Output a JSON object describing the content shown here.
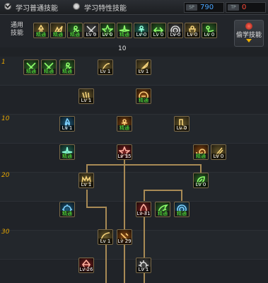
{
  "tabs": {
    "normal_label": "学习普通技能",
    "special_label": "学习特性技能"
  },
  "resources": {
    "sp": {
      "icon": "sp-icon",
      "value": "790",
      "color": "#4aa6ff"
    },
    "tp": {
      "icon": "tp-icon",
      "value": "0",
      "color": "#ff4a3a"
    }
  },
  "common": {
    "label": "通用\n技能",
    "counter": "10",
    "learn_button": "偷学技能",
    "skills": [
      {
        "badge": "精通",
        "tone": "gold",
        "icon": "warrior-icon"
      },
      {
        "badge": "精通",
        "tone": "gold",
        "icon": "leap-icon"
      },
      {
        "badge": "精通",
        "tone": "green",
        "icon": "runner-icon"
      },
      {
        "badge": "Lv 0",
        "tone": "gray",
        "icon": "cross-icon"
      },
      {
        "badge": "Lv 0",
        "tone": "green",
        "icon": "star-icon"
      },
      {
        "badge": "精通",
        "tone": "green",
        "icon": "burst-icon"
      },
      {
        "badge": "Lv 0",
        "tone": "teal",
        "icon": "figure-icon"
      },
      {
        "badge": "Lv 0",
        "tone": "green",
        "icon": "arrows-icon"
      },
      {
        "badge": "Lv 0",
        "tone": "gray",
        "icon": "ring-icon"
      },
      {
        "badge": "Lv 0",
        "tone": "gold",
        "icon": "man-icon"
      },
      {
        "badge": "Lv 0",
        "tone": "green",
        "icon": "kick-icon"
      }
    ]
  },
  "levels": [
    "1",
    "10",
    "20",
    "30"
  ],
  "tree_skills": [
    {
      "badge": "精通",
      "tone": "green",
      "icon": "swords-icon"
    },
    {
      "badge": "精通",
      "tone": "green",
      "icon": "cross-icon"
    },
    {
      "badge": "精通",
      "tone": "green",
      "icon": "runner-icon"
    },
    {
      "badge": "Lv 1",
      "tone": "gold",
      "icon": "slash-icon"
    },
    {
      "badge": "Lv 1",
      "tone": "gold",
      "icon": "blade-icon"
    },
    {
      "badge": "Lv 1",
      "tone": "gold",
      "icon": "claw-icon"
    },
    {
      "badge": "精通",
      "tone": "orange",
      "icon": "orb-icon"
    },
    {
      "badge": "Lv 1",
      "tone": "blue",
      "icon": "flame-icon"
    },
    {
      "badge": "精通",
      "tone": "orange",
      "icon": "figure-icon"
    },
    {
      "badge": "Lv 0",
      "tone": "gold",
      "icon": "boot-icon"
    },
    {
      "badge": "精通",
      "tone": "teal",
      "icon": "burst-icon"
    },
    {
      "badge": "Lv 15",
      "tone": "red",
      "icon": "star-icon"
    },
    {
      "badge": "精通",
      "tone": "orange",
      "icon": "vortex-icon"
    },
    {
      "badge": "Lv 0",
      "tone": "gold",
      "icon": "cut-icon"
    },
    {
      "badge": "Lv 1",
      "tone": "gold",
      "icon": "crown-icon"
    },
    {
      "badge": "Lv 0",
      "tone": "green",
      "icon": "leaf-icon"
    },
    {
      "badge": "精通",
      "tone": "blue",
      "icon": "gear-icon"
    },
    {
      "badge": "Lv 31",
      "tone": "red",
      "icon": "fire-icon"
    },
    {
      "badge": "精通",
      "tone": "green",
      "icon": "wing-icon"
    },
    {
      "badge": "精通",
      "tone": "blue",
      "icon": "ring-icon"
    },
    {
      "badge": "Lv 1",
      "tone": "gold",
      "icon": "arc-icon"
    },
    {
      "badge": "Lv 29",
      "tone": "orange",
      "icon": "strike-icon"
    },
    {
      "badge": "Lv 26",
      "tone": "red",
      "icon": "crystal-icon"
    },
    {
      "badge": "Lv 1",
      "tone": "gray",
      "icon": "cog-icon"
    }
  ]
}
